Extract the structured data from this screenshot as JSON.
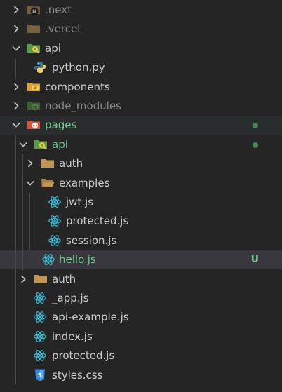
{
  "colors": {
    "text": "#cccccc",
    "dimmed": "#8b8b8b",
    "git_modified": "#73c991",
    "git_untracked": "#73c991",
    "badge_dot": "#3f8a4d",
    "selected_bg": "#37373d",
    "hover_bg": "#2a2d2e",
    "guide": "#444648"
  },
  "explorer": {
    "items": [
      {
        "label": ".next",
        "depth": 0,
        "type": "folder",
        "expanded": false,
        "icon": "next-folder-icon",
        "dimmed": true
      },
      {
        "label": ".vercel",
        "depth": 0,
        "type": "folder",
        "expanded": false,
        "icon": "folder-icon",
        "dimmed": true
      },
      {
        "label": "api",
        "depth": 0,
        "type": "folder",
        "expanded": true,
        "icon": "api-folder-icon"
      },
      {
        "label": "python.py",
        "depth": 1,
        "type": "file",
        "icon": "python-icon"
      },
      {
        "label": "components",
        "depth": 0,
        "type": "folder",
        "expanded": false,
        "icon": "components-folder-icon"
      },
      {
        "label": "node_modules",
        "depth": 0,
        "type": "folder",
        "expanded": false,
        "icon": "node-folder-icon",
        "dimmed": true
      },
      {
        "label": "pages",
        "depth": 0,
        "type": "folder",
        "expanded": true,
        "icon": "pages-folder-icon",
        "git": "modified",
        "dot": true
      },
      {
        "label": "api",
        "depth": 1,
        "type": "folder",
        "expanded": true,
        "icon": "api-folder-icon",
        "git": "modified",
        "dot": true
      },
      {
        "label": "auth",
        "depth": 2,
        "type": "folder",
        "expanded": false,
        "icon": "folder-icon"
      },
      {
        "label": "examples",
        "depth": 2,
        "type": "folder",
        "expanded": true,
        "icon": "folder-open-icon"
      },
      {
        "label": "jwt.js",
        "depth": 3,
        "type": "file",
        "icon": "react-icon"
      },
      {
        "label": "protected.js",
        "depth": 3,
        "type": "file",
        "icon": "react-icon"
      },
      {
        "label": "session.js",
        "depth": 3,
        "type": "file",
        "icon": "react-icon"
      },
      {
        "label": "hello.js",
        "depth": 2,
        "type": "file",
        "icon": "react-icon",
        "git": "untracked",
        "badge": "U",
        "selected": true
      },
      {
        "label": "auth",
        "depth": 1,
        "type": "folder",
        "expanded": false,
        "icon": "folder-icon"
      },
      {
        "label": "_app.js",
        "depth": 1,
        "type": "file",
        "icon": "react-icon"
      },
      {
        "label": "api-example.js",
        "depth": 1,
        "type": "file",
        "icon": "react-icon"
      },
      {
        "label": "index.js",
        "depth": 1,
        "type": "file",
        "icon": "react-icon"
      },
      {
        "label": "protected.js",
        "depth": 1,
        "type": "file",
        "icon": "react-icon"
      },
      {
        "label": "styles.css",
        "depth": 1,
        "type": "file",
        "icon": "css-icon"
      }
    ]
  }
}
